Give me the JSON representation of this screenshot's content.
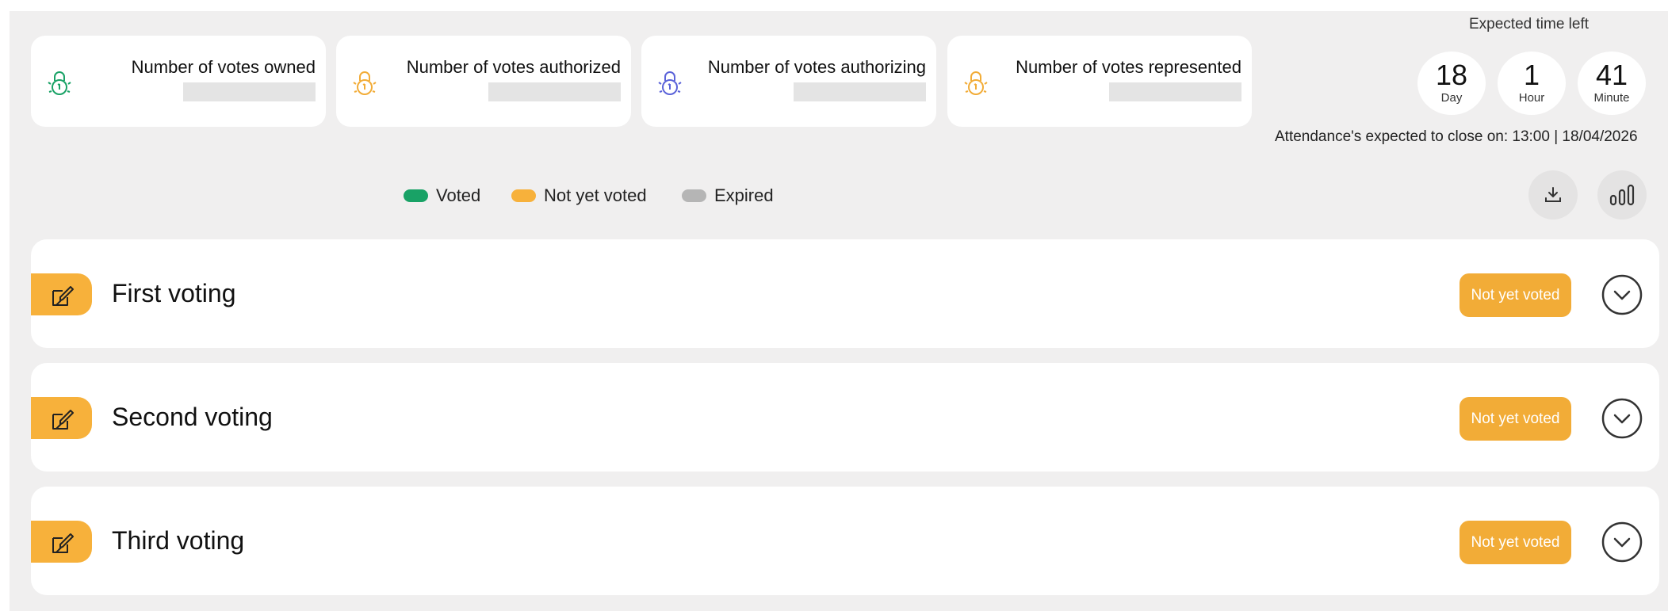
{
  "stats": [
    {
      "label": "Number of votes owned",
      "icon": "lock-icon",
      "color": "#19a266"
    },
    {
      "label": "Number of votes authorized",
      "icon": "lock-icon",
      "color": "#f2ac37"
    },
    {
      "label": "Number of votes authorizing",
      "icon": "lock-icon",
      "color": "#5b63d9"
    },
    {
      "label": "Number of votes represented",
      "icon": "lock-icon",
      "color": "#f2ac37"
    }
  ],
  "timer": {
    "title": "Expected time left",
    "days": {
      "value": "18",
      "unit": "Day"
    },
    "hours": {
      "value": "1",
      "unit": "Hour"
    },
    "minutes": {
      "value": "41",
      "unit": "Minute"
    },
    "close_text": "Attendance's expected to close on: 13:00 | 18/04/2026"
  },
  "legend": [
    {
      "label": "Voted",
      "color": "#19a266"
    },
    {
      "label": "Not yet voted",
      "color": "#f7b13b"
    },
    {
      "label": "Expired",
      "color": "#b5b5b5"
    }
  ],
  "toolbar": {
    "download_icon": "download-icon",
    "chart_icon": "bar-chart-icon"
  },
  "votings": [
    {
      "title": "First voting",
      "status": "Not yet voted"
    },
    {
      "title": "Second voting",
      "status": "Not yet voted"
    },
    {
      "title": "Third voting",
      "status": "Not yet voted"
    }
  ],
  "colors": {
    "accent": "#f2ac37",
    "background": "#f0efef",
    "card": "#ffffff"
  }
}
